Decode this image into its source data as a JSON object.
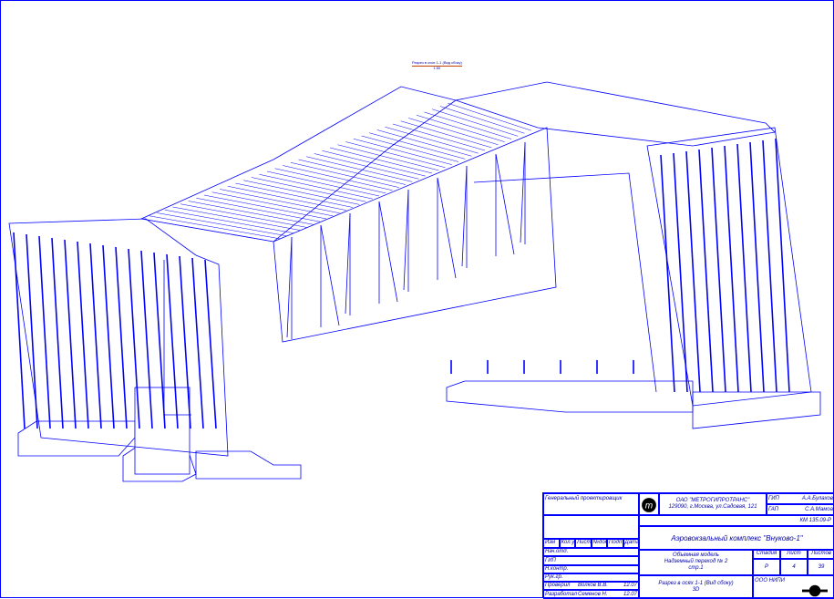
{
  "caption": {
    "title": "Разрез в осях 1-1 (Вид сбоку)",
    "scale": "1:50"
  },
  "title_block": {
    "designer": "Генеральный проектировщик",
    "company": "ОАО \"МЕТРОГИПРОТРАНС\"",
    "address": "129090, г.Москва, ул.Садовая, 121",
    "gip_label": "ГИП",
    "gip_name": "А.А.Булахов",
    "gap_label": "ГАП",
    "gap_name": "С.А.Мамоа",
    "code": "КМ 135.09-Р",
    "project": "Аэровокзальный комплекс \"Внуково-1\"",
    "columns": [
      "Изм",
      "Кол.уч",
      "Лист",
      "№док",
      "Подп",
      "Дата"
    ],
    "roles": [
      "Нач.отд.",
      "ГИП",
      "Н.контр.",
      "Рук.гр.",
      "Проверил",
      "Разработал"
    ],
    "names": [
      "Волков В.В.",
      "Семенов Н."
    ],
    "dates": [
      "12.07",
      "12.07"
    ],
    "sheet_title": [
      "Объемная модель",
      "Надземный переход № 2",
      "стр.1"
    ],
    "stage_label": "Стадия",
    "sheet_label": "Лист",
    "sheets_label": "Листов",
    "stage": "Р",
    "sheet": "4",
    "sheets": "39",
    "drawing_title": [
      "Разрез в осях 1-1 (Вид сбоку)",
      "3D"
    ],
    "org_code": "ООО НИПИ"
  }
}
